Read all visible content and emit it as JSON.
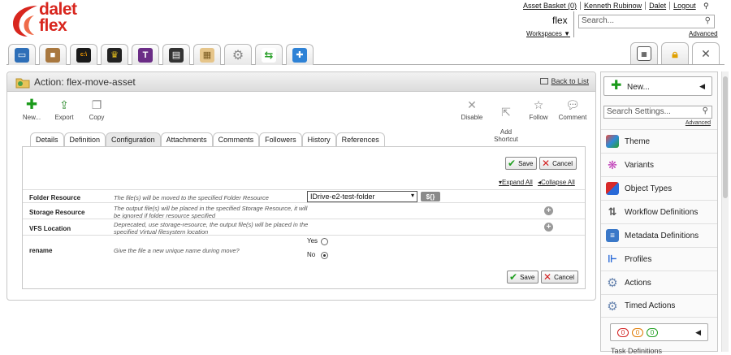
{
  "brand": {
    "line1": "dalet",
    "line2": "flex",
    "color": "#d8261e"
  },
  "top_links": [
    "Asset Basket (0)",
    "Kenneth Rubinow",
    "Dalet",
    "Logout"
  ],
  "workspace": {
    "name": "flex",
    "link": "Workspaces ▼"
  },
  "top_search": {
    "placeholder": "Search...",
    "advanced": "Advanced"
  },
  "app_tabs": [
    {
      "icon": "window-icon"
    },
    {
      "icon": "box-icon"
    },
    {
      "icon": "terminal-icon"
    },
    {
      "icon": "trophy-icon"
    },
    {
      "icon": "t-icon"
    },
    {
      "icon": "clapper-icon"
    },
    {
      "icon": "clipboard-icon"
    },
    {
      "icon": "gear-icon"
    },
    {
      "icon": "workflow-icon"
    },
    {
      "icon": "puzzle-icon"
    }
  ],
  "right_tabs": [
    {
      "icon": "calculator-icon"
    },
    {
      "icon": "lock-icon"
    },
    {
      "icon": "tools-icon"
    }
  ],
  "main": {
    "title": "Action: flex-move-asset",
    "back_link": "Back to List",
    "tools_left": [
      {
        "label": "New..."
      },
      {
        "label": "Export"
      },
      {
        "label": "Copy"
      }
    ],
    "tools_right": [
      {
        "label": "Disable"
      },
      {
        "label": "Add\nShortcut"
      },
      {
        "label": "Follow"
      },
      {
        "label": "Comment"
      }
    ],
    "tabs": [
      "Details",
      "Definition",
      "Configuration",
      "Attachments",
      "Comments",
      "Followers",
      "History",
      "References"
    ],
    "active_tab": "Configuration",
    "save_label": "Save",
    "cancel_label": "Cancel",
    "expand_all": "Expand All",
    "collapse_all": "Collapse All",
    "rows": [
      {
        "label": "Folder Resource",
        "desc": "The file(s) will be moved to the specified Folder Resource",
        "value": "IDrive-e2-test-folder",
        "var_button": "${}"
      },
      {
        "label": "Storage Resource",
        "desc": "The output file(s) will be placed in the specified Storage Resource, it will be ignored if folder resource specified"
      },
      {
        "label": "VFS Location",
        "desc": "Deprecated, use storage-resource, the output file(s) will be placed in the specified Virtual filesystem location"
      },
      {
        "label": "rename",
        "desc": "Give the file a new unique name during move?",
        "yes": "Yes",
        "no": "No",
        "selected": "No"
      }
    ]
  },
  "sidebar": {
    "new_label": "New...",
    "search_placeholder": "Search Settings...",
    "advanced": "Advanced",
    "items": [
      {
        "label": "Theme",
        "icon": "theme-icon"
      },
      {
        "label": "Variants",
        "icon": "variants-icon"
      },
      {
        "label": "Object Types",
        "icon": "object-types-icon"
      },
      {
        "label": "Workflow Definitions",
        "icon": "workflow-definitions-icon"
      },
      {
        "label": "Metadata Definitions",
        "icon": "metadata-definitions-icon"
      },
      {
        "label": "Profiles",
        "icon": "profiles-icon"
      },
      {
        "label": "Actions",
        "icon": "actions-gear-icon"
      },
      {
        "label": "Timed Actions",
        "icon": "timed-actions-gear-icon"
      }
    ],
    "counts": [
      "0",
      "0",
      "0"
    ],
    "partial_item": "Task Definitions"
  }
}
